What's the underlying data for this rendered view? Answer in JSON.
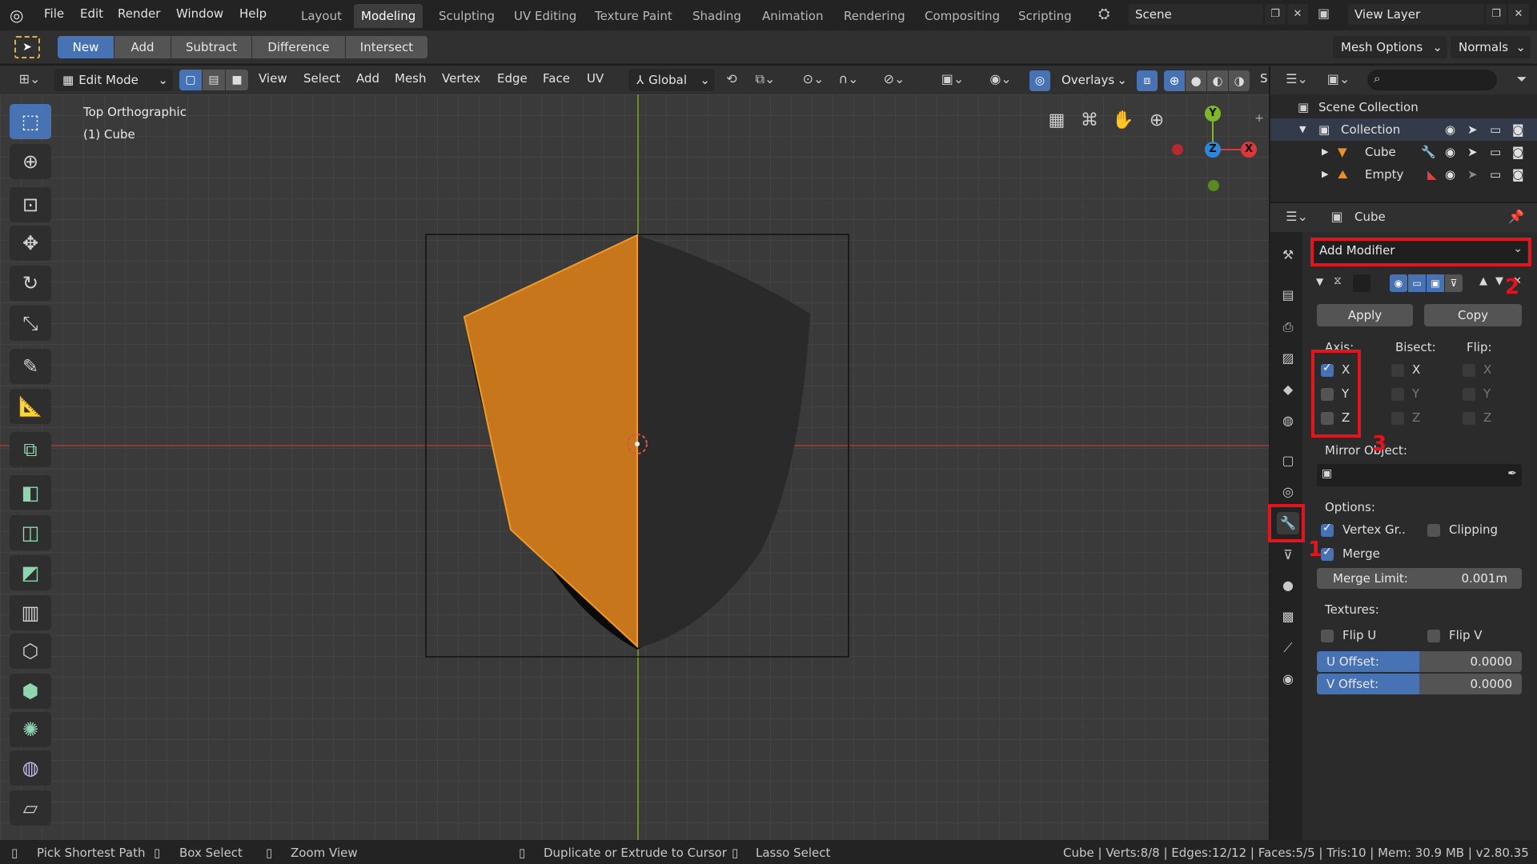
{
  "menubar": {
    "menus": [
      "File",
      "Edit",
      "Render",
      "Window",
      "Help"
    ],
    "workspaces": [
      "Layout",
      "Modeling",
      "Sculpting",
      "UV Editing",
      "Texture Paint",
      "Shading",
      "Animation",
      "Rendering",
      "Compositing",
      "Scripting"
    ],
    "active_workspace": "Modeling",
    "scene": "Scene",
    "view_layer": "View Layer"
  },
  "toolsettings": {
    "modes": [
      "New",
      "Add",
      "Subtract",
      "Difference",
      "Intersect"
    ],
    "active_mode": "New",
    "mesh_options": "Mesh Options",
    "normals": "Normals"
  },
  "viewport_header": {
    "mode": "Edit Mode",
    "menus": [
      "View",
      "Select",
      "Add",
      "Mesh",
      "Vertex",
      "Edge",
      "Face",
      "UV"
    ],
    "transform_orientation": "Global",
    "overlays": "Overlays",
    "s_label": "S"
  },
  "viewport": {
    "view_name": "Top Orthographic",
    "object_label": "(1) Cube",
    "gizmo": {
      "y": "Y",
      "x": "X",
      "z": "Z"
    }
  },
  "outliner": {
    "scene_collection": "Scene Collection",
    "collection": "Collection",
    "items": [
      "Cube",
      "Empty"
    ]
  },
  "properties": {
    "object_name": "Cube",
    "add_modifier": "Add Modifier",
    "apply": "Apply",
    "copy": "Copy",
    "axis_label": "Axis:",
    "bisect_label": "Bisect:",
    "flip_label": "Flip:",
    "axes": [
      "X",
      "Y",
      "Z"
    ],
    "axis_checked": [
      true,
      false,
      false
    ],
    "mirror_object_label": "Mirror Object:",
    "options_label": "Options:",
    "vertex_groups": "Vertex Gr..",
    "vertex_groups_checked": true,
    "clipping": "Clipping",
    "clipping_checked": false,
    "merge": "Merge",
    "merge_checked": true,
    "merge_limit_label": "Merge Limit:",
    "merge_limit_value": "0.001m",
    "textures_label": "Textures:",
    "flip_u": "Flip U",
    "flip_v": "Flip V",
    "u_offset_label": "U Offset:",
    "u_offset_value": "0.0000",
    "v_offset_label": "V Offset:",
    "v_offset_value": "0.0000"
  },
  "annotations": [
    "1",
    "2",
    "3"
  ],
  "statusbar": {
    "items": [
      "Pick Shortest Path",
      "Box Select",
      "Zoom View",
      "Duplicate or Extrude to Cursor",
      "Lasso Select"
    ],
    "stats": "Cube | Verts:8/8 | Edges:12/12 | Faces:5/5 | Tris:10 | Mem: 30.9 MB | v2.80.35"
  },
  "colors": {
    "accent": "#4772b3",
    "selected_face": "#c87a1e",
    "annotation_red": "#e4141e"
  }
}
